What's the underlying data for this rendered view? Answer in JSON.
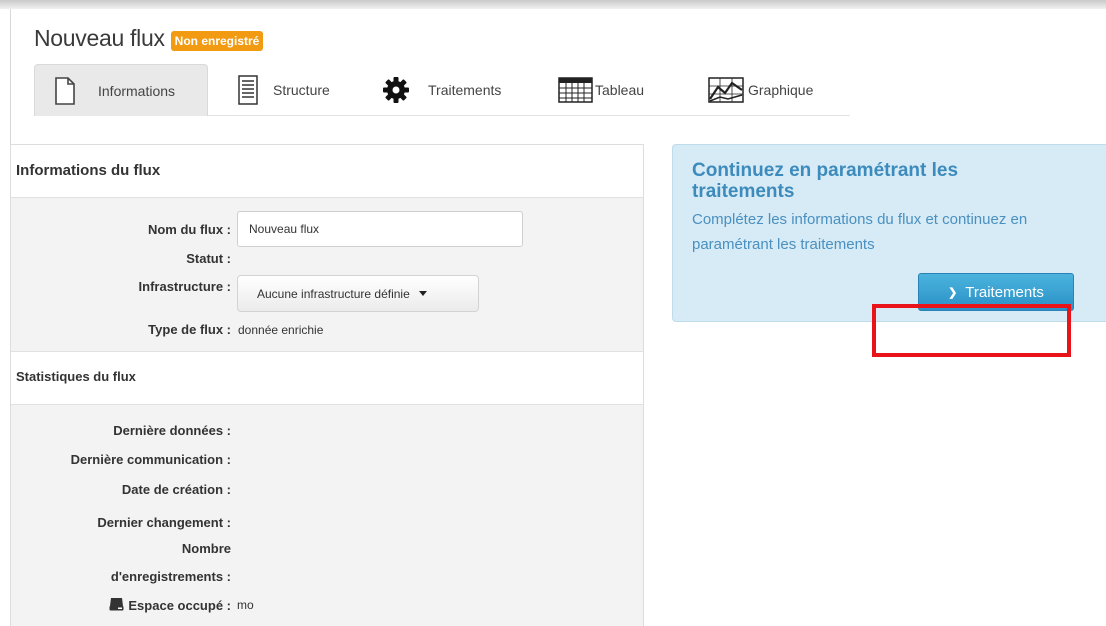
{
  "header": {
    "title": "Nouveau flux",
    "badge": "Non enregistré"
  },
  "tabs": [
    {
      "label": "Informations",
      "icon": "document-icon",
      "active": true
    },
    {
      "label": "Structure",
      "icon": "lines-document-icon",
      "active": false
    },
    {
      "label": "Traitements",
      "icon": "gear-icon",
      "active": false
    },
    {
      "label": "Tableau",
      "icon": "table-grid-icon",
      "active": false
    },
    {
      "label": "Graphique",
      "icon": "chart-icon",
      "active": false
    }
  ],
  "info_section": {
    "heading": "Informations du flux",
    "fields": {
      "name_label": "Nom du flux :",
      "name_value": "Nouveau flux",
      "status_label": "Statut :",
      "infra_label": "Infrastructure :",
      "infra_value": "Aucune infrastructure définie",
      "type_label": "Type de flux :",
      "type_value": "donnée enrichie"
    }
  },
  "stats_section": {
    "heading": "Statistiques du flux",
    "last_data_label": "Dernière données :",
    "last_comm_label": "Dernière communication :",
    "creation_label": "Date de création :",
    "last_change_label": "Dernier changement :",
    "records_label_1": "Nombre",
    "records_label_2": "d'enregistrements :",
    "space_label": "Espace occupé :",
    "space_value": "mo"
  },
  "callout": {
    "title": "Continuez en paramétrant les traitements",
    "text": "Complétez les informations du flux et continuez en paramétrant les traitements",
    "button_label": "Traitements"
  },
  "colors": {
    "badge": "#f19a12",
    "callout_bg": "#d6ebf5",
    "callout_title": "#3d8bbd",
    "button": "#2a90c7",
    "highlight": "#e8141a"
  }
}
